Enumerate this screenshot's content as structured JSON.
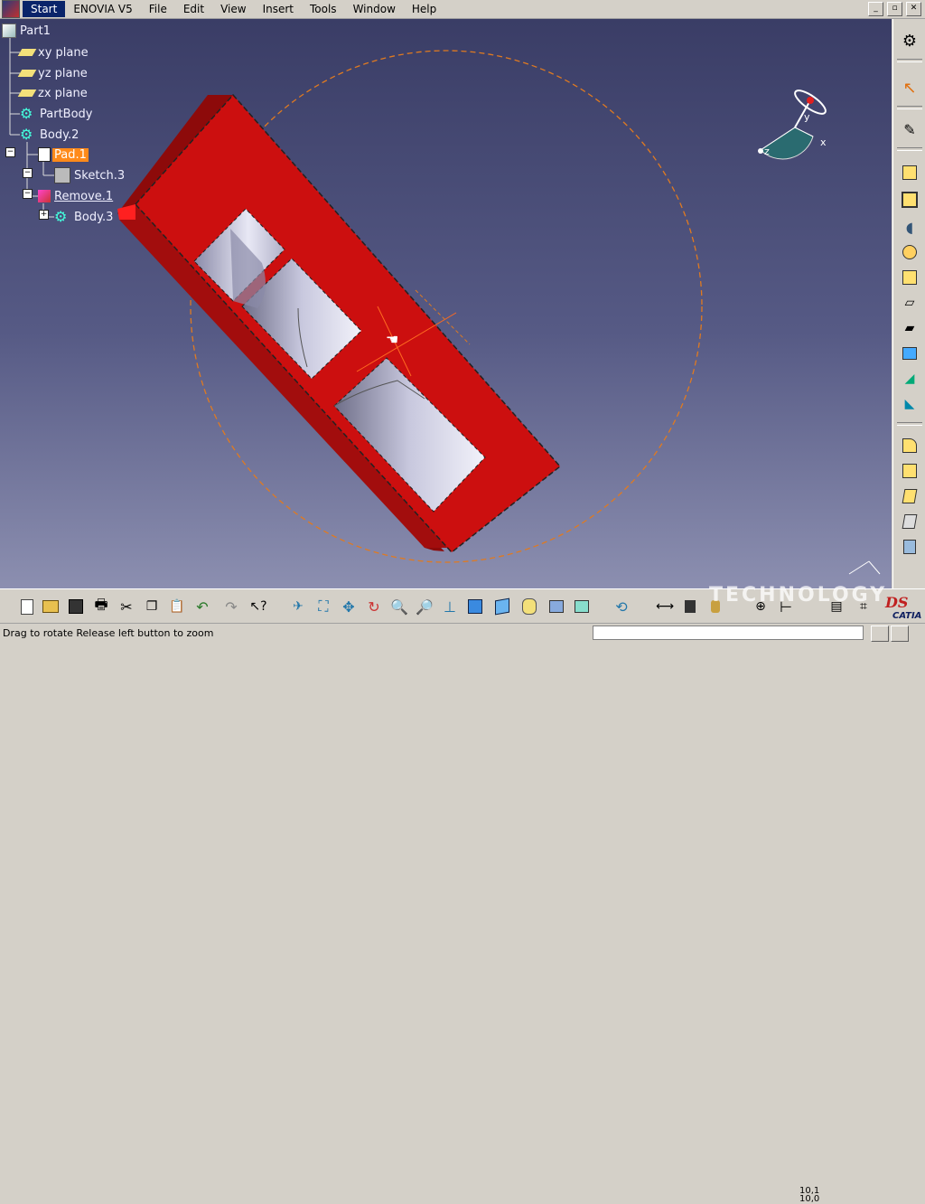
{
  "menu": {
    "start": "Start",
    "enovia": "ENOVIA V5",
    "file": "File",
    "edit": "Edit",
    "view": "View",
    "insert": "Insert",
    "tools": "Tools",
    "window": "Window",
    "help": "Help"
  },
  "tree": {
    "root": "Part1",
    "xy": "xy plane",
    "yz": "yz plane",
    "zx": "zx plane",
    "partbody": "PartBody",
    "body2": "Body.2",
    "pad1": "Pad.1",
    "sketch3": "Sketch.3",
    "remove1": "Remove.1",
    "body3": "Body.3"
  },
  "compass": {
    "x": "x",
    "y": "y",
    "z": "z"
  },
  "status": {
    "message": "Drag to rotate  Release left button to zoom",
    "command_value": ""
  },
  "scale": {
    "top": "10,1",
    "bottom": "10,0"
  },
  "watermark": "TECHNOLOGY",
  "brand": {
    "catia": "CATIA"
  },
  "colors": {
    "part": "#cc0f0f",
    "selection": "#ff8a1a",
    "viewport_top": "#3a3d66",
    "viewport_bottom": "#8c8fb0"
  }
}
